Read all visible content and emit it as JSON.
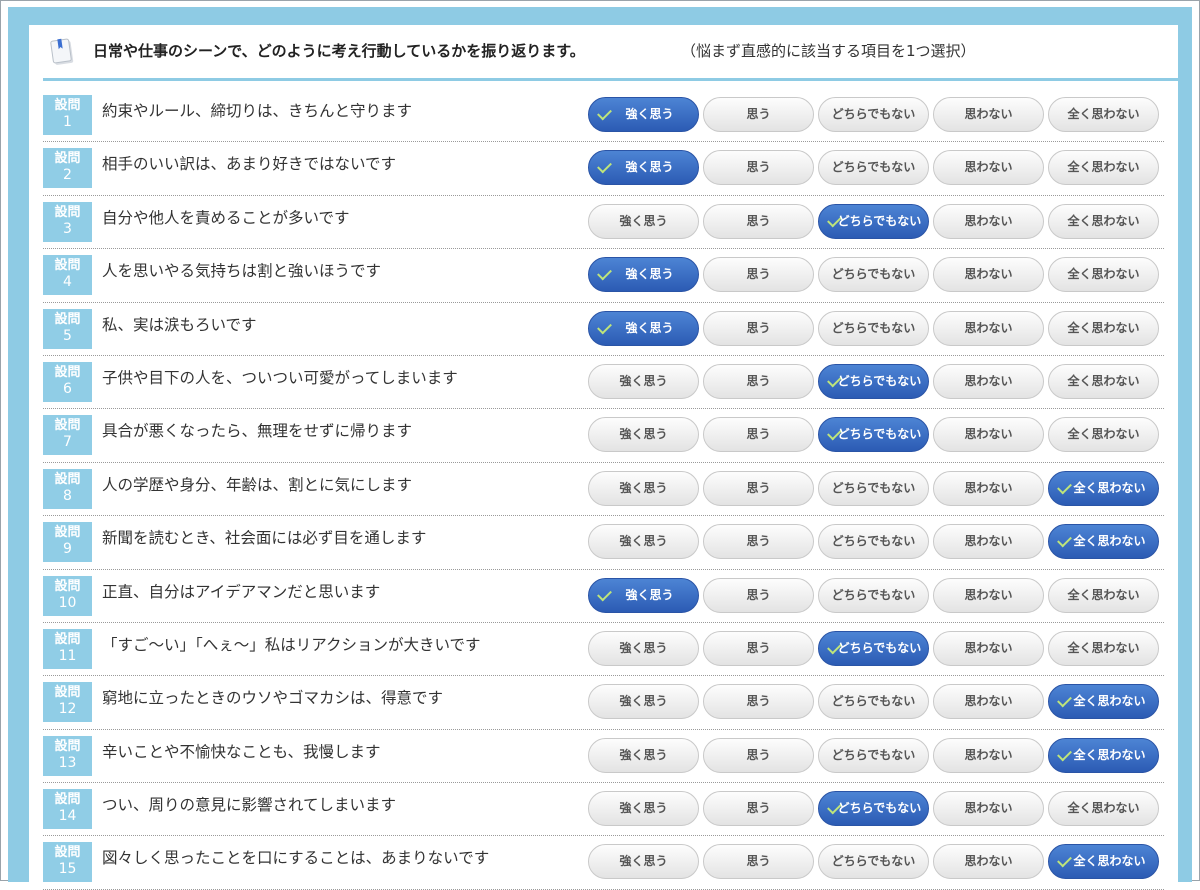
{
  "header": {
    "title": "日常や仕事のシーンで、どのように考え行動しているかを振り返ります。",
    "note": "（悩まず直感的に該当する項目を1つ選択）"
  },
  "question_label": "設問",
  "options": [
    "強く思う",
    "思う",
    "どちらでもない",
    "思わない",
    "全く思わない"
  ],
  "colors": {
    "frame": "#8ecbe4",
    "badge": "#90cde6",
    "selected": "#2f62bd",
    "check": "#bfe57a"
  },
  "questions": [
    {
      "num": "1",
      "text": "約束やルール、締切りは、きちんと守ります",
      "selected": 0
    },
    {
      "num": "2",
      "text": "相手のいい訳は、あまり好きではないです",
      "selected": 0
    },
    {
      "num": "3",
      "text": "自分や他人を責めることが多いです",
      "selected": 2
    },
    {
      "num": "4",
      "text": "人を思いやる気持ちは割と強いほうです",
      "selected": 0
    },
    {
      "num": "5",
      "text": "私、実は涙もろいです",
      "selected": 0
    },
    {
      "num": "6",
      "text": "子供や目下の人を、ついつい可愛がってしまいます",
      "selected": 2
    },
    {
      "num": "7",
      "text": "具合が悪くなったら、無理をせずに帰ります",
      "selected": 2
    },
    {
      "num": "8",
      "text": "人の学歴や身分、年齢は、割とに気にします",
      "selected": 4
    },
    {
      "num": "9",
      "text": "新聞を読むとき、社会面には必ず目を通します",
      "selected": 4
    },
    {
      "num": "10",
      "text": "正直、自分はアイデアマンだと思います",
      "selected": 0
    },
    {
      "num": "11",
      "text": "「すご～い」「へぇ～」私はリアクションが大きいです",
      "selected": 2
    },
    {
      "num": "12",
      "text": "窮地に立ったときのウソやゴマカシは、得意です",
      "selected": 4
    },
    {
      "num": "13",
      "text": "辛いことや不愉快なことも、我慢します",
      "selected": 4
    },
    {
      "num": "14",
      "text": "つい、周りの意見に影響されてしまいます",
      "selected": 2
    },
    {
      "num": "15",
      "text": "図々しく思ったことを口にすることは、あまりないです",
      "selected": 4
    }
  ]
}
